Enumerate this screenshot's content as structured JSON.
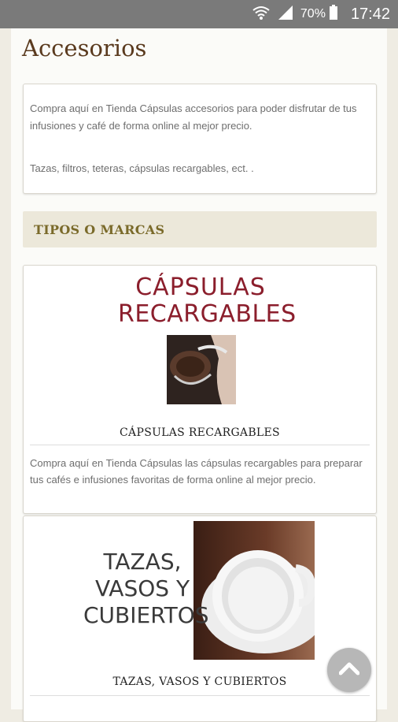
{
  "status_bar": {
    "battery_percent": "70%",
    "time": "17:42"
  },
  "page": {
    "title": "Accesorios",
    "intro": {
      "paragraph1": "Compra aquí en Tienda Cápsulas accesorios para poder disfrutar de tus infusiones y café de forma online al mejor precio.",
      "paragraph2": "Tazas, filtros, teteras, cápsulas recargables, ect. ."
    },
    "section_title": "TIPOS O MARCAS",
    "cards": [
      {
        "image_text_line1": "CÁPSULAS",
        "image_text_line2": "RECARGABLES",
        "title": "CÁPSULAS RECARGABLES",
        "description": "Compra aquí en Tienda Cápsulas las cápsulas recargables para preparar tus cafés e infusiones favoritas de forma online al mejor precio."
      },
      {
        "image_text_line1": "TAZAS,",
        "image_text_line2": "VASOS Y",
        "image_text_line3": "CUBIERTOS",
        "title": "TAZAS, VASOS Y CUBIERTOS"
      }
    ]
  },
  "icons": {
    "wifi": "wifi-icon",
    "signal": "signal-icon",
    "battery": "battery-icon",
    "scroll_top": "chevron-up-icon"
  }
}
